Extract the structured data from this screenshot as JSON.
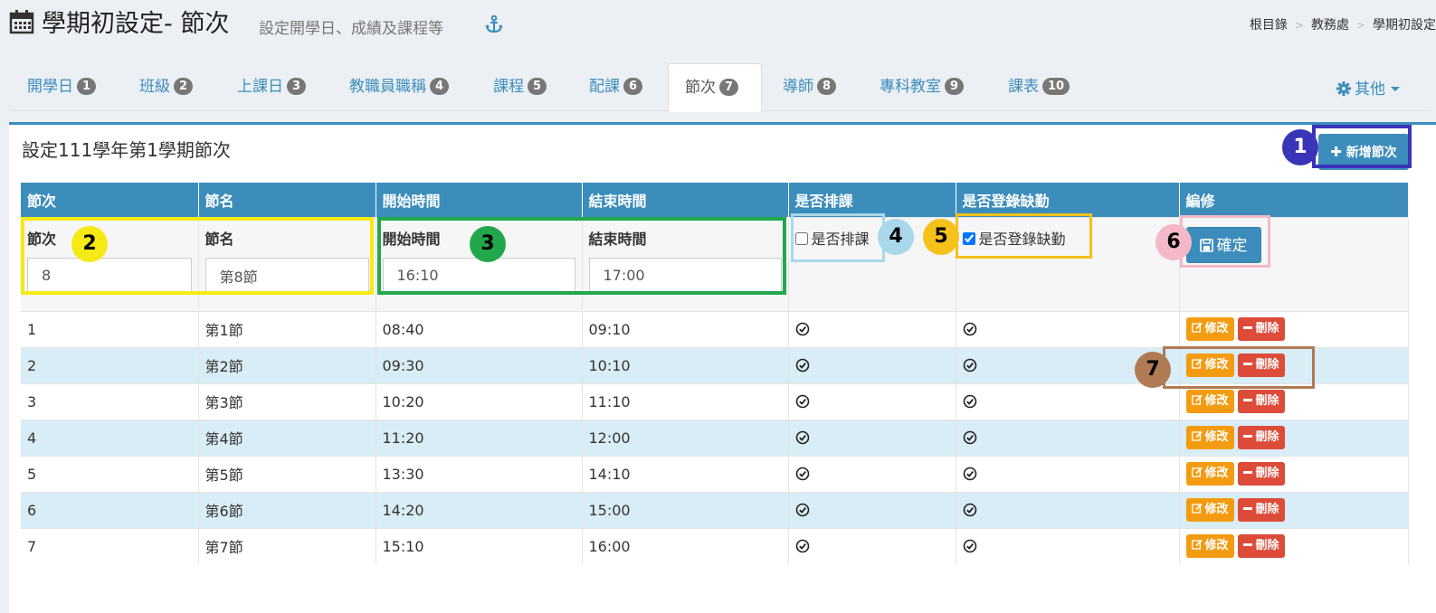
{
  "header": {
    "title": "學期初設定- 節次",
    "subtitle": "設定開學日、成績及課程等",
    "breadcrumb": [
      "根目錄",
      "教務處",
      "學期初設定"
    ]
  },
  "tabs": [
    {
      "label": "開學日",
      "badge": "1"
    },
    {
      "label": "班級",
      "badge": "2"
    },
    {
      "label": "上課日",
      "badge": "3"
    },
    {
      "label": "教職員職稱",
      "badge": "4"
    },
    {
      "label": "課程",
      "badge": "5"
    },
    {
      "label": "配課",
      "badge": "6"
    },
    {
      "label": "節次",
      "badge": "7",
      "active": true
    },
    {
      "label": "導師",
      "badge": "8"
    },
    {
      "label": "專科教室",
      "badge": "9"
    },
    {
      "label": "課表",
      "badge": "10"
    }
  ],
  "other_menu": {
    "label": "其他"
  },
  "panel": {
    "title": "設定111學年第1學期節次",
    "add_button": "新增節次"
  },
  "table": {
    "headers": [
      "節次",
      "節名",
      "開始時間",
      "結束時間",
      "是否排課",
      "是否登錄缺勤",
      "編修"
    ],
    "form": {
      "period_label": "節次",
      "period_value": "8",
      "name_label": "節名",
      "name_value": "第8節",
      "start_label": "開始時間",
      "start_value": "16:10",
      "end_label": "結束時間",
      "end_value": "17:00",
      "schedule_checkbox_label": "是否排課",
      "schedule_checked": false,
      "attendance_checkbox_label": "是否登錄缺勤",
      "attendance_checked": true,
      "confirm_button": "確定"
    },
    "rows": [
      {
        "period": "1",
        "name": "第1節",
        "start": "08:40",
        "end": "09:10"
      },
      {
        "period": "2",
        "name": "第2節",
        "start": "09:30",
        "end": "10:10"
      },
      {
        "period": "3",
        "name": "第3節",
        "start": "10:20",
        "end": "11:10"
      },
      {
        "period": "4",
        "name": "第4節",
        "start": "11:20",
        "end": "12:00"
      },
      {
        "period": "5",
        "name": "第5節",
        "start": "13:30",
        "end": "14:10"
      },
      {
        "period": "6",
        "name": "第6節",
        "start": "14:20",
        "end": "15:00"
      },
      {
        "period": "7",
        "name": "第7節",
        "start": "15:10",
        "end": "16:00"
      }
    ],
    "edit_label": "修改",
    "delete_label": "刪除"
  },
  "annotations": [
    {
      "number": "1",
      "color": "#3a34b8",
      "text_color": "#ffffff"
    },
    {
      "number": "2",
      "color": "#f5ea14",
      "text_color": "#000000"
    },
    {
      "number": "3",
      "color": "#22a84a",
      "text_color": "#000000"
    },
    {
      "number": "4",
      "color": "#a8d8ea",
      "text_color": "#000000"
    },
    {
      "number": "5",
      "color": "#f5c11a",
      "text_color": "#000000"
    },
    {
      "number": "6",
      "color": "#f5b8c8",
      "text_color": "#000000"
    },
    {
      "number": "7",
      "color": "#b07a55",
      "text_color": "#000000"
    }
  ],
  "colors": {
    "primary": "#3c8dbc",
    "warning": "#f39c12",
    "danger": "#dd4b39",
    "row_alt": "#d9edf7"
  }
}
